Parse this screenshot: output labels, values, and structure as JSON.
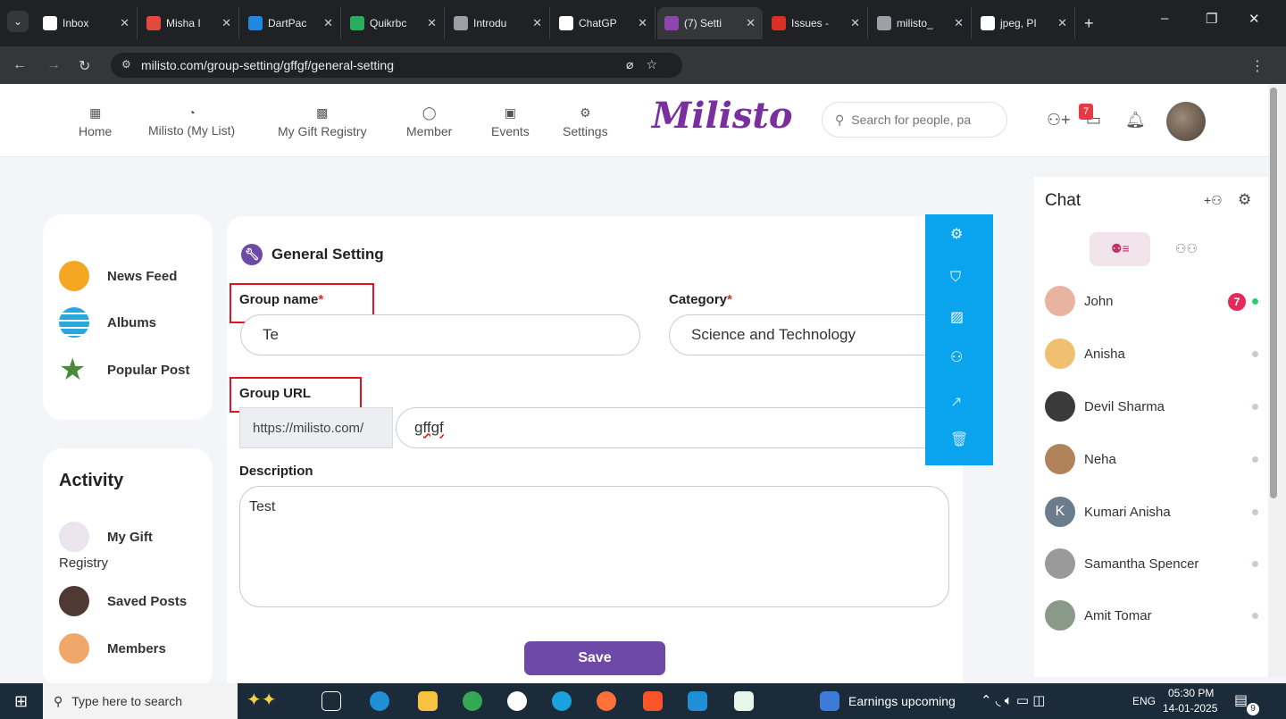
{
  "browser": {
    "tabs": [
      {
        "title": "Inbox",
        "color": "#ffffff"
      },
      {
        "title": "Misha I",
        "color": "#e24a3b"
      },
      {
        "title": "DartPac",
        "color": "#1e88e5"
      },
      {
        "title": "Quikrbc",
        "color": "#27ae60"
      },
      {
        "title": "Introdu",
        "color": "#9aa0a6"
      },
      {
        "title": "ChatGP",
        "color": "#ffffff"
      },
      {
        "title": "(7) Setti",
        "color": "#8e44ad"
      },
      {
        "title": "Issues -",
        "color": "#d93025"
      },
      {
        "title": "milisto_",
        "color": "#9aa0a6"
      },
      {
        "title": "jpeg, PI",
        "color": "#ffffff"
      }
    ],
    "url": "milisto.com/group-setting/gffgf/general-setting",
    "new_tab": "+"
  },
  "header": {
    "nav": [
      {
        "label": "Home"
      },
      {
        "label": "Milisto (My List)"
      },
      {
        "label": "My Gift Registry"
      },
      {
        "label": "Member"
      },
      {
        "label": "Events"
      },
      {
        "label": "Settings"
      }
    ],
    "logo": "Milisto",
    "search_placeholder": "Search for people, pa",
    "message_badge": "7"
  },
  "left_menu": [
    {
      "label": "News Feed",
      "color": "#f5a623"
    },
    {
      "label": "Albums",
      "color": "#29a8e0"
    },
    {
      "label": "Popular Post",
      "color": "#4a8a3a"
    }
  ],
  "activity": {
    "title": "Activity",
    "items": [
      {
        "label_line1": "My Gift",
        "label_line2": "Registry"
      },
      {
        "label_line1": "Saved Posts",
        "label_line2": ""
      },
      {
        "label_line1": "Members",
        "label_line2": ""
      }
    ]
  },
  "form": {
    "title": "General Setting",
    "group_name_label": "Group name",
    "group_name_value": "Te",
    "category_label": "Category",
    "category_value": "Science and Technology",
    "group_url_label": "Group URL",
    "url_prefix": "https://milisto.com/",
    "url_value": "gffgf",
    "description_label": "Description",
    "description_value": "Test",
    "required_mark": "*",
    "save_label": "Save"
  },
  "chat": {
    "title": "Chat",
    "contacts": [
      {
        "name": "John",
        "online": true,
        "unread": "7",
        "avatar": "#e8b4a0"
      },
      {
        "name": "Anisha",
        "online": false,
        "unread": "",
        "avatar": "#f0c070"
      },
      {
        "name": "Devil Sharma",
        "online": false,
        "unread": "",
        "avatar": "#3a3a3a"
      },
      {
        "name": "Neha",
        "online": false,
        "unread": "",
        "avatar": "#b0835a"
      },
      {
        "name": "Kumari Anisha",
        "online": false,
        "unread": "",
        "avatar": "#6b7d8c",
        "initial": "K"
      },
      {
        "name": "Samantha Spencer",
        "online": false,
        "unread": "",
        "avatar": "#9a9a9a"
      },
      {
        "name": "Amit Tomar",
        "online": false,
        "unread": "",
        "avatar": "#8a9a88"
      }
    ]
  },
  "taskbar": {
    "search_placeholder": "Type here to search",
    "news": "Earnings upcoming",
    "lang": "ENG",
    "time": "05:30 PM",
    "date": "14-01-2025",
    "notif_count": "9"
  }
}
